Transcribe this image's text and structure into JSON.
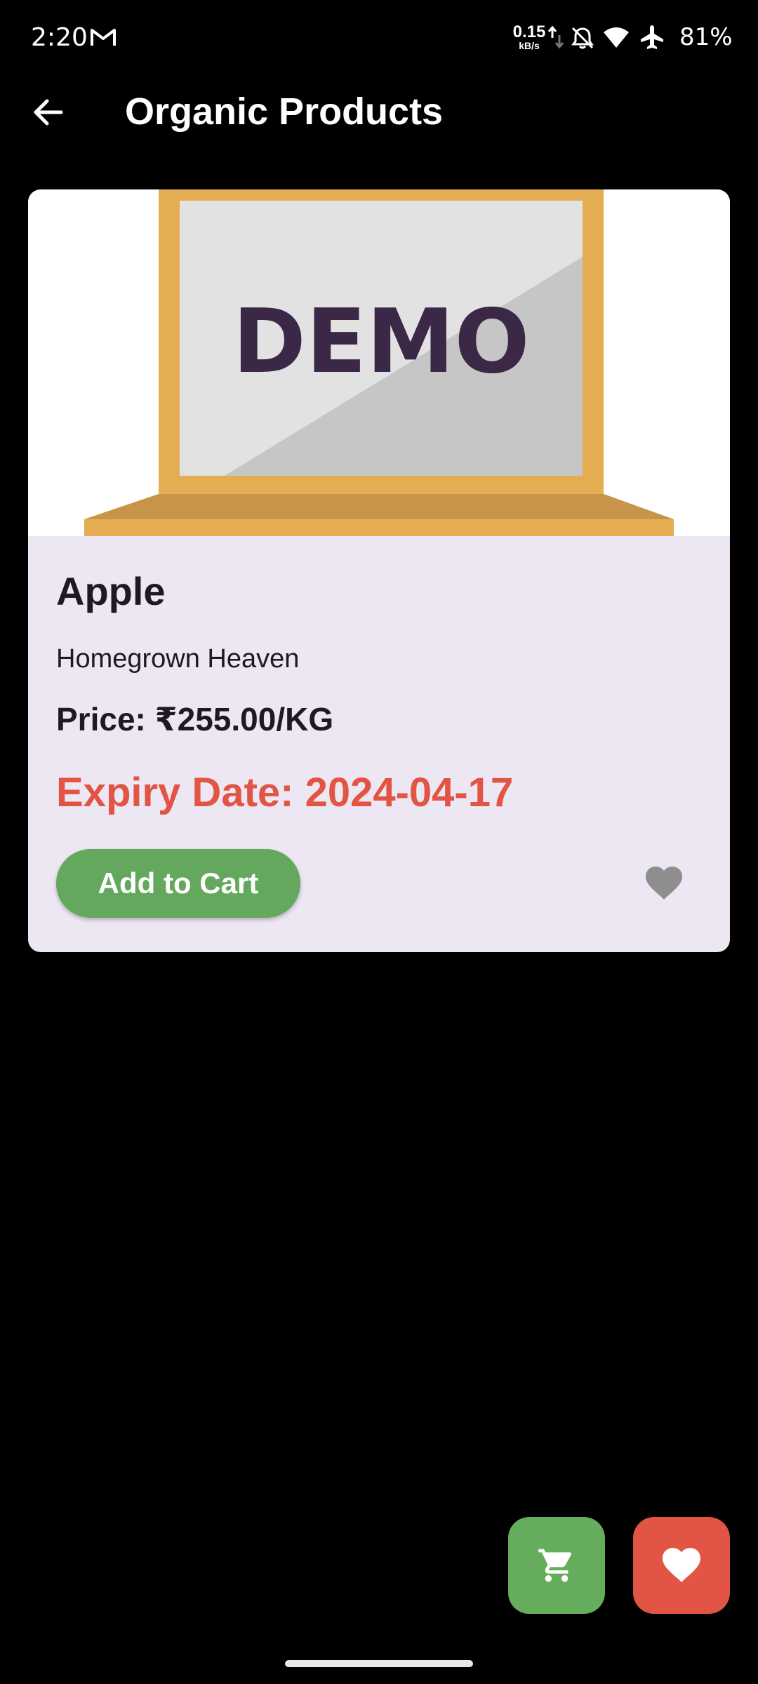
{
  "status_bar": {
    "time": "2:20",
    "net_speed_value": "0.15",
    "net_speed_unit": "kB/s",
    "battery": "81%",
    "icons": [
      "gmail-icon",
      "network-arrows-icon",
      "bell-off-icon",
      "wifi-icon",
      "airplane-icon"
    ]
  },
  "app_bar": {
    "back_icon": "arrow-back-icon",
    "title": "Organic Products"
  },
  "product": {
    "image_text": "DEMO",
    "name": "Apple",
    "brand": "Homegrown Heaven",
    "price": "Price: ₹255.00/KG",
    "expiry": "Expiry Date: 2024-04-17",
    "add_to_cart_label": "Add to Cart",
    "favorite_icon": "heart-icon"
  },
  "fabs": {
    "cart_icon": "cart-icon",
    "favorites_icon": "heart-icon"
  },
  "colors": {
    "background": "#000000",
    "card": "#ece7f3",
    "primary_green": "#63a85c",
    "expiry_red": "#e25443",
    "favorite_gray": "#8e8e8e",
    "laptop_frame": "#e5ad52"
  }
}
